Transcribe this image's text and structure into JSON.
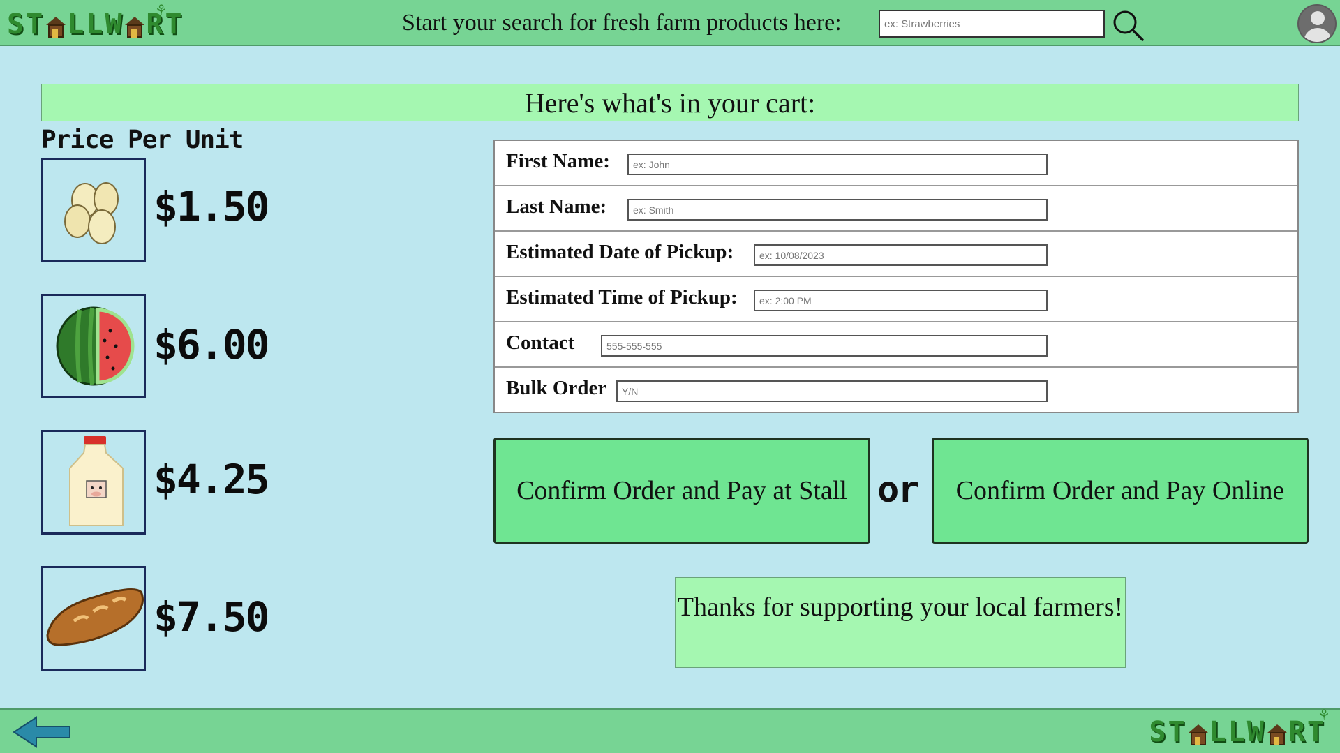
{
  "header": {
    "logo_text": "STALLWART",
    "search_label": "Start your search for fresh farm products here:",
    "search_placeholder": "ex: Strawberries"
  },
  "icons": {
    "search": "search-icon",
    "user": "user-avatar-icon",
    "back": "back-arrow-icon"
  },
  "cart": {
    "banner": "Here's what's in your cart:",
    "price_heading": "Price Per Unit",
    "items": [
      {
        "name": "Eggs",
        "icon": "eggs-icon",
        "price": "$1.50"
      },
      {
        "name": "Watermelon",
        "icon": "watermelon-icon",
        "price": "$6.00"
      },
      {
        "name": "Milk",
        "icon": "milk-jug-icon",
        "price": "$4.25"
      },
      {
        "name": "Bread",
        "icon": "bread-icon",
        "price": "$7.50"
      }
    ]
  },
  "form": {
    "first_name": {
      "label": "First Name:",
      "placeholder": "ex: John"
    },
    "last_name": {
      "label": "Last Name:",
      "placeholder": "ex: Smith"
    },
    "pickup_date": {
      "label": "Estimated Date of Pickup:",
      "placeholder": "ex: 10/08/2023"
    },
    "pickup_time": {
      "label": "Estimated Time of Pickup:",
      "placeholder": "ex: 2:00 PM"
    },
    "contact": {
      "label": "Contact",
      "placeholder": "555-555-555"
    },
    "bulk_order": {
      "label": "Bulk Order",
      "placeholder": "Y/N"
    }
  },
  "actions": {
    "pay_at_stall": "Confirm Order and Pay at Stall",
    "or": "or",
    "pay_online": "Confirm Order and Pay Online"
  },
  "thanks_message": "Thanks for supporting your local farmers!",
  "colors": {
    "bar_green": "#77d494",
    "page_bg": "#bde7ef",
    "banner_green": "#a5f7b1",
    "button_green": "#6fe592",
    "logo_green": "#2f8a2f"
  }
}
